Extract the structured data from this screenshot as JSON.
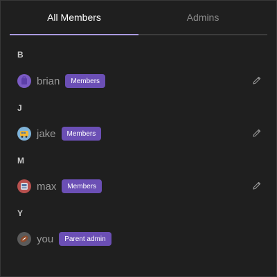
{
  "tabs": {
    "all_members": "All Members",
    "admins": "Admins"
  },
  "groups": [
    {
      "letter": "B",
      "member": {
        "name": "brian",
        "role": "Members",
        "avatar_icon": "purple-bag-avatar-icon",
        "editable": true
      }
    },
    {
      "letter": "J",
      "member": {
        "name": "jake",
        "role": "Members",
        "avatar_icon": "school-bus-avatar-icon",
        "editable": true
      }
    },
    {
      "letter": "M",
      "member": {
        "name": "max",
        "role": "Members",
        "avatar_icon": "tram-avatar-icon",
        "editable": true
      }
    },
    {
      "letter": "Y",
      "member": {
        "name": "you",
        "role": "Parent admin",
        "avatar_icon": "football-avatar-icon",
        "editable": false
      }
    }
  ],
  "colors": {
    "background": "#1f1f1f",
    "accent_indicator": "#a99ae0",
    "badge": "#6b4fb5"
  }
}
